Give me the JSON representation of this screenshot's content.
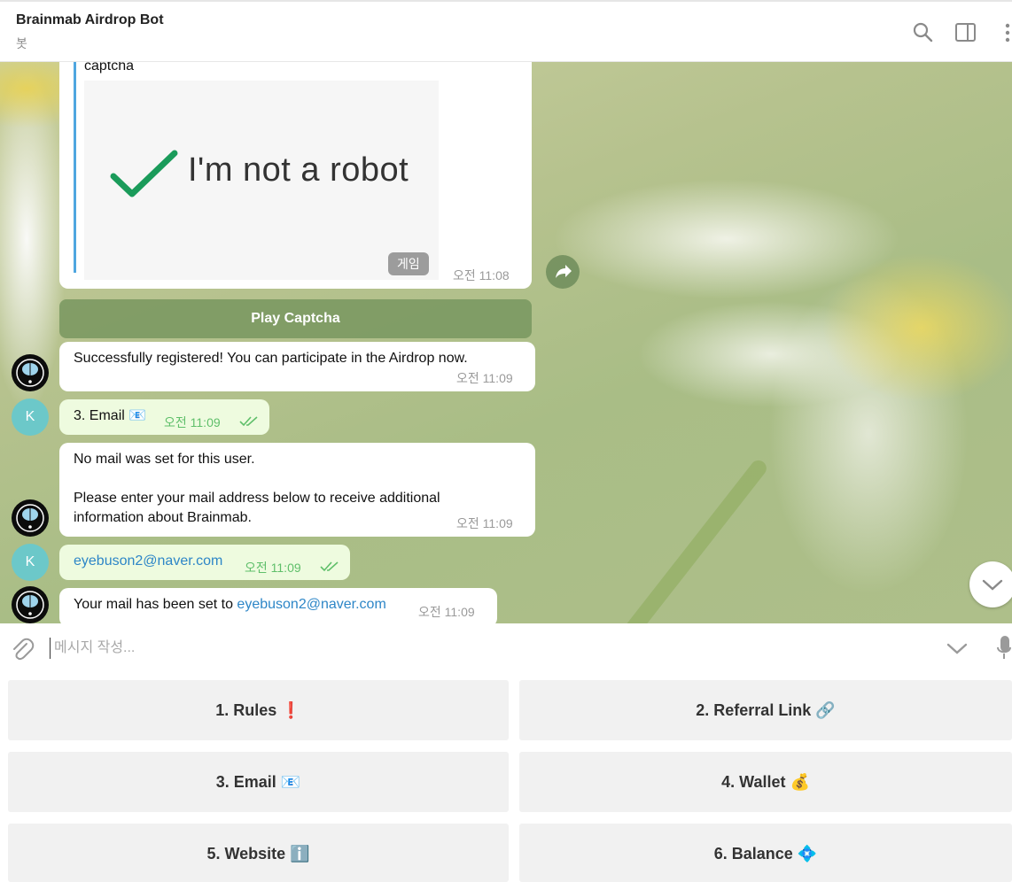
{
  "header": {
    "title": "Brainmab Airdrop Bot",
    "subtitle": "봇"
  },
  "messages": {
    "captcha": {
      "label": "captcha",
      "image_text": "I'm not a robot",
      "badge": "게임",
      "time": "오전 11:08",
      "button": "Play Captcha"
    },
    "registered": {
      "text": "Successfully registered! You can participate in the Airdrop now.",
      "time": "오전 11:09"
    },
    "user_email_choice": {
      "avatar": "K",
      "text": "3. Email 📧",
      "time": "오전 11:09"
    },
    "no_mail": {
      "line1": "No mail was set for this user.",
      "line2": "Please enter your mail address below to receive additional",
      "line3": "information about Brainmab.",
      "time": "오전 11:09"
    },
    "user_email": {
      "avatar": "K",
      "text": "eyebuson2@naver.com",
      "time": "오전 11:09"
    },
    "mail_set": {
      "prefix": "Your mail has been set to ",
      "email": "eyebuson2@naver.com",
      "time": "오전 11:09"
    }
  },
  "composer": {
    "placeholder": "메시지 작성..."
  },
  "keyboard": {
    "buttons": [
      {
        "label": "1. Rules ❗"
      },
      {
        "label": "2. Referral Link 🔗"
      },
      {
        "label": "3. Email 📧"
      },
      {
        "label": "4. Wallet 💰"
      },
      {
        "label": "5. Website ℹ️"
      },
      {
        "label": "6. Balance 💠"
      }
    ]
  },
  "colors": {
    "accent_link": "#2d86c7",
    "outgoing_bubble": "#eefbdf",
    "check_green": "#5fbf6a",
    "captcha_check": "#1a9b5a"
  }
}
